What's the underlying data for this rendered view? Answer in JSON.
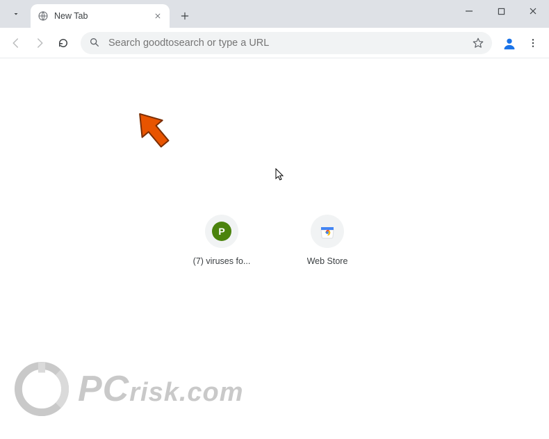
{
  "window": {
    "tab_title": "New Tab"
  },
  "omnibox": {
    "placeholder": "Search goodtosearch or type a URL"
  },
  "shortcuts": [
    {
      "label": "(7) viruses fo...",
      "icon_letter": "P"
    },
    {
      "label": "Web Store"
    }
  ],
  "watermark": {
    "text_prefix": "PC",
    "text_suffix": "risk.com"
  },
  "colors": {
    "tab_strip_bg": "#dee1e6",
    "omnibox_bg": "#f1f3f4",
    "text_muted": "#5f6368",
    "shortcut_p_bg": "#4b830d",
    "arrow": "#e85400",
    "profile_blue": "#1a73e8"
  }
}
